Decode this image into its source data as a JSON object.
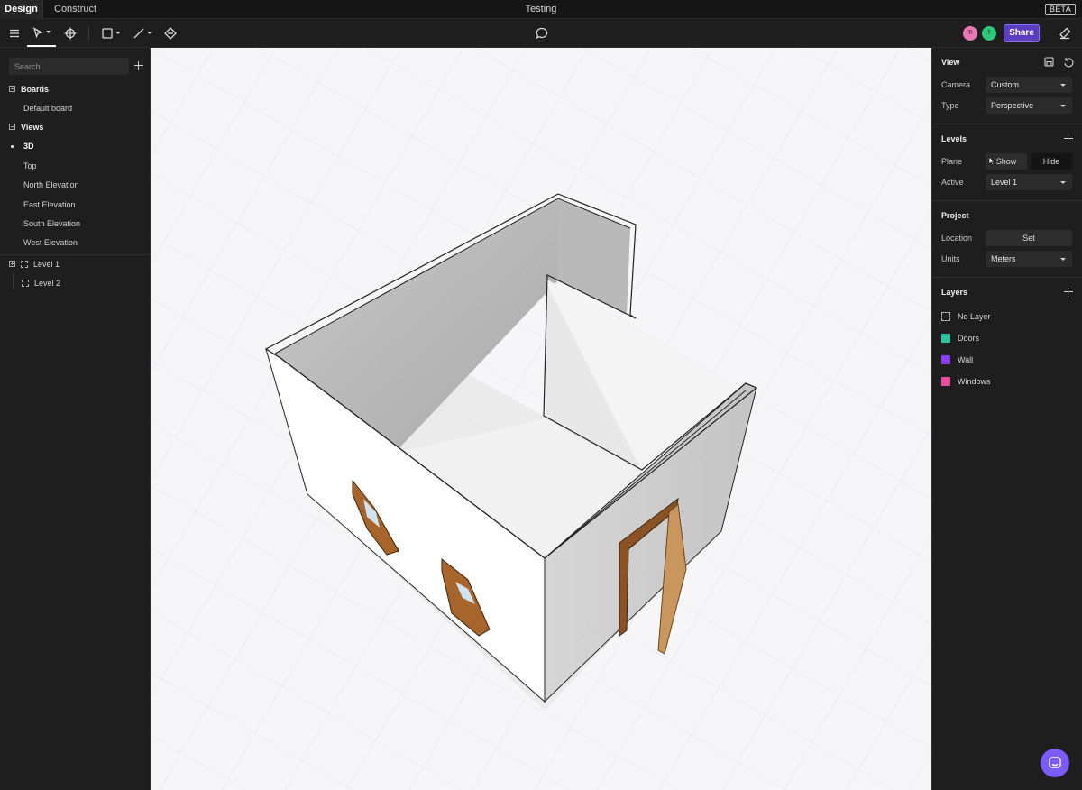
{
  "titlebar": {
    "tabs": [
      {
        "label": "Design"
      },
      {
        "label": "Construct"
      }
    ],
    "title": "Testing",
    "badge": "BETA"
  },
  "toolbar": {
    "menu_icon": "hamburger-icon",
    "select_tool_icon": "pointer-icon",
    "pan_tool_icon": "move-icon",
    "rectangle_tool_icon": "square-icon",
    "line_tool_icon": "line-icon",
    "fill_tool_icon": "bucket-icon",
    "comment_icon": "speech-bubble-icon",
    "avatars": [
      {
        "initials": "TI",
        "color": "#e879b4"
      },
      {
        "initials": "T",
        "color": "#2fc77a"
      }
    ],
    "share_label": "Share",
    "eraser_icon": "eraser-icon"
  },
  "left_panel": {
    "search_placeholder": "Search",
    "boards_title": "Boards",
    "boards": [
      {
        "label": "Default board"
      }
    ],
    "views_title": "Views",
    "views": [
      {
        "label": "3D",
        "active": true
      },
      {
        "label": "Top"
      },
      {
        "label": "North Elevation"
      },
      {
        "label": "East Elevation"
      },
      {
        "label": "South Elevation"
      },
      {
        "label": "West Elevation"
      }
    ],
    "levels": [
      {
        "label": "Level 1"
      },
      {
        "label": "Level 2"
      }
    ]
  },
  "right_panel": {
    "view": {
      "title": "View",
      "camera_label": "Camera",
      "camera_value": "Custom",
      "type_label": "Type",
      "type_value": "Perspective"
    },
    "levels": {
      "title": "Levels",
      "plane_label": "Plane",
      "show_label": "Show",
      "hide_label": "Hide",
      "active_label": "Active",
      "active_value": "Level 1"
    },
    "project": {
      "title": "Project",
      "location_label": "Location",
      "location_button": "Set",
      "units_label": "Units",
      "units_value": "Meters"
    },
    "layers": {
      "title": "Layers",
      "items": [
        {
          "label": "No Layer",
          "color": "none"
        },
        {
          "label": "Doors",
          "color": "#2ec4a0"
        },
        {
          "label": "Wall",
          "color": "#8b3ff0"
        },
        {
          "label": "Windows",
          "color": "#ea4f9a"
        }
      ]
    }
  }
}
